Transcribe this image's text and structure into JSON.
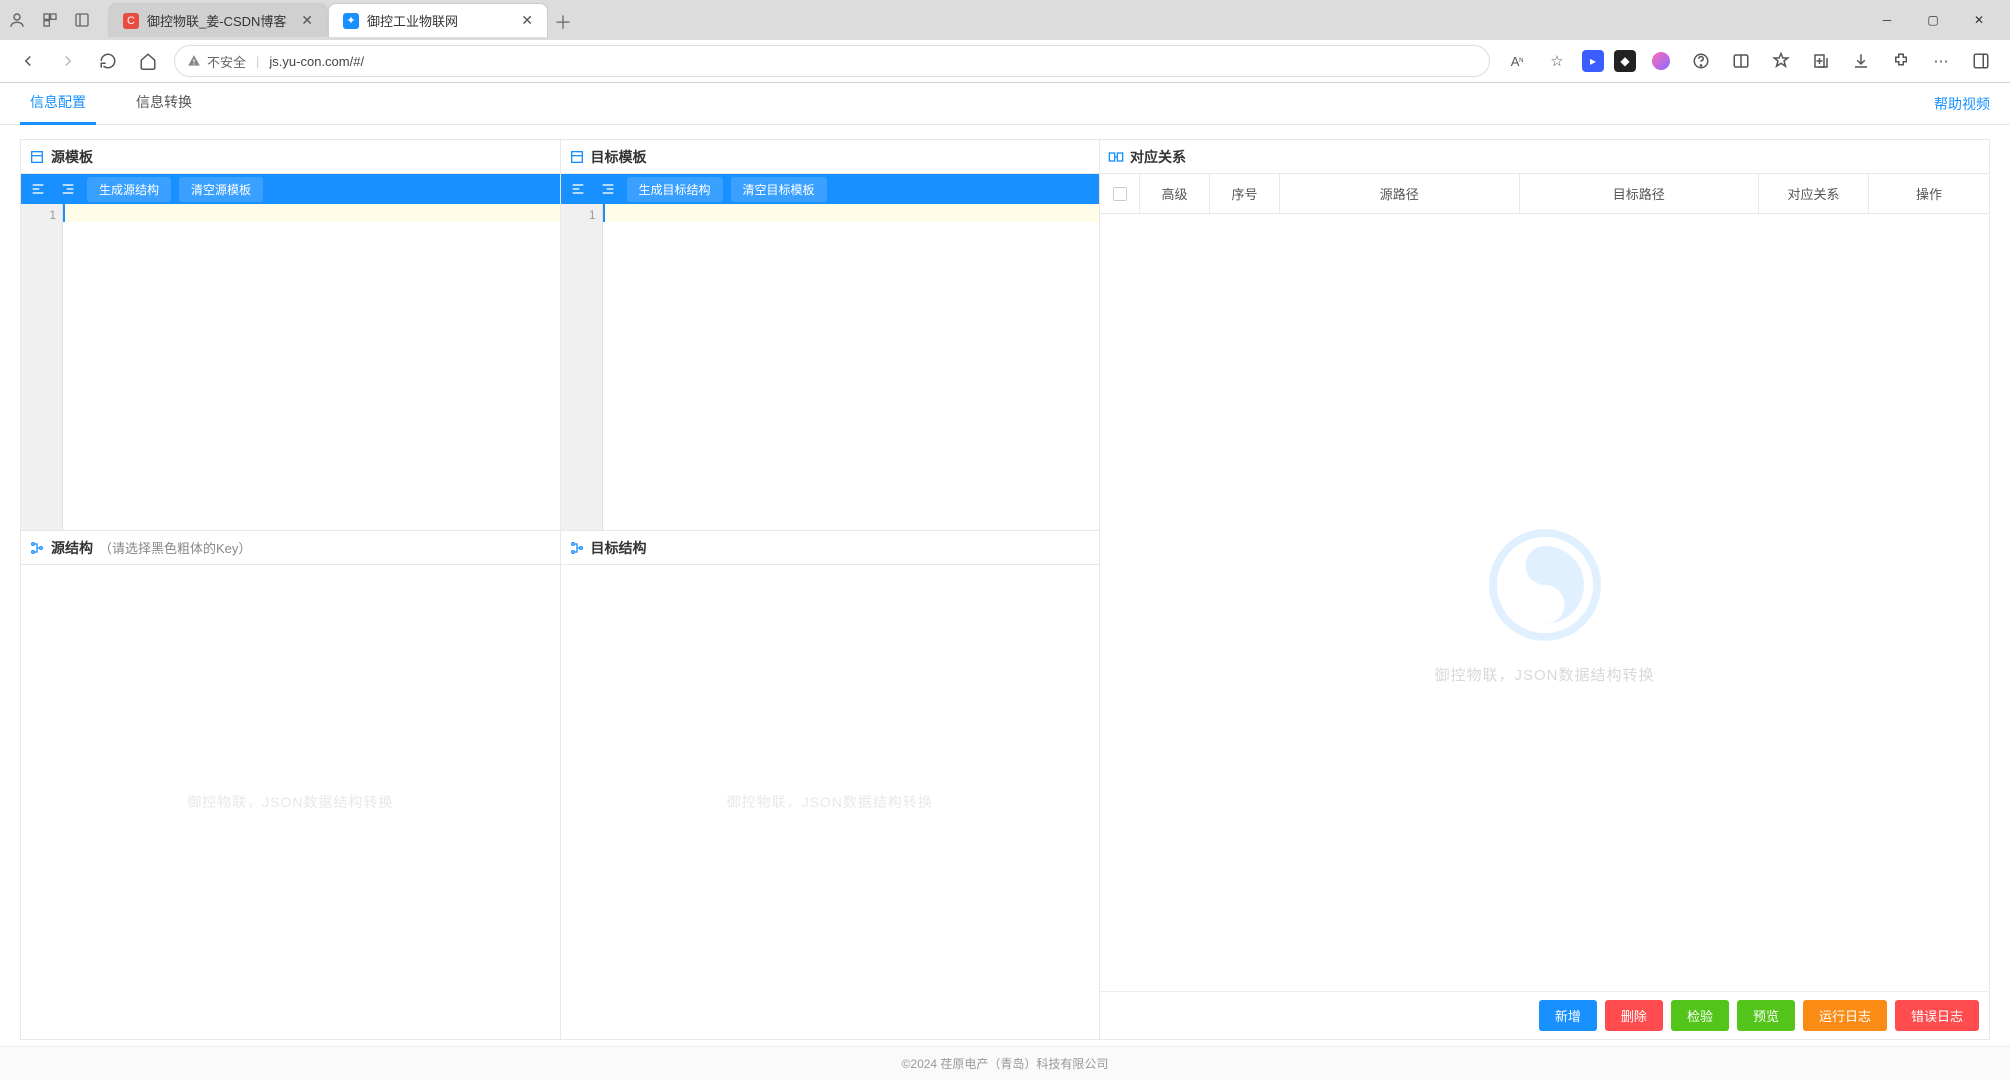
{
  "browser": {
    "tabs": [
      {
        "title": "御控物联_姜-CSDN博客"
      },
      {
        "title": "御控工业物联网"
      }
    ],
    "url_security": "不安全",
    "url": "js.yu-con.com/#/"
  },
  "nav": {
    "tab1": "信息配置",
    "tab2": "信息转换",
    "help": "帮助视频"
  },
  "panels": {
    "src_tpl": {
      "title": "源模板",
      "btn_gen": "生成源结构",
      "btn_clear": "清空源模板",
      "gutter": "1"
    },
    "dst_tpl": {
      "title": "目标模板",
      "btn_gen": "生成目标结构",
      "btn_clear": "清空目标模板",
      "gutter": "1"
    },
    "src_struct": {
      "title": "源结构",
      "hint": "（请选择黑色粗体的Key）"
    },
    "dst_struct": {
      "title": "目标结构"
    },
    "watermark": "御控物联，JSON数据结构转换"
  },
  "relation": {
    "title": "对应关系",
    "cols": {
      "c1": "高级",
      "c2": "序号",
      "c3": "源路径",
      "c4": "目标路径",
      "c5": "对应关系",
      "c6": "操作"
    },
    "watermark": "御控物联，JSON数据结构转换"
  },
  "buttons": {
    "add": "新增",
    "del": "删除",
    "check": "检验",
    "prev": "预览",
    "runlog": "运行日志",
    "errlog": "错误日志"
  },
  "footer": "©2024 荏原电产（青岛）科技有限公司"
}
